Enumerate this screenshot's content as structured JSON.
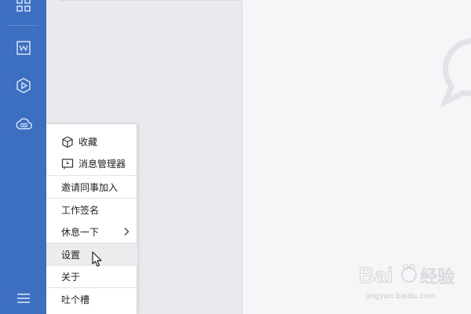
{
  "sidebar": {
    "icons": [
      "grid-icon",
      "document-w-icon",
      "play-hexagon-icon",
      "cloud-link-icon",
      "menu-hamburger-icon"
    ]
  },
  "menu": {
    "items": [
      {
        "label": "收藏",
        "icon": "cube-icon"
      },
      {
        "label": "消息管理器",
        "icon": "message-manager-icon"
      },
      {
        "label": "邀请同事加入"
      },
      {
        "label": "工作签名"
      },
      {
        "label": "休息一下",
        "has_submenu": true
      },
      {
        "label": "设置",
        "hovered": true
      },
      {
        "label": "关于"
      },
      {
        "label": "吐个槽"
      }
    ]
  },
  "watermark": {
    "brand": "Bai 经验",
    "url": "jingyan.baidu.com"
  },
  "colors": {
    "sidebar": "#3c6fbf",
    "menu_hover": "#ececee"
  }
}
